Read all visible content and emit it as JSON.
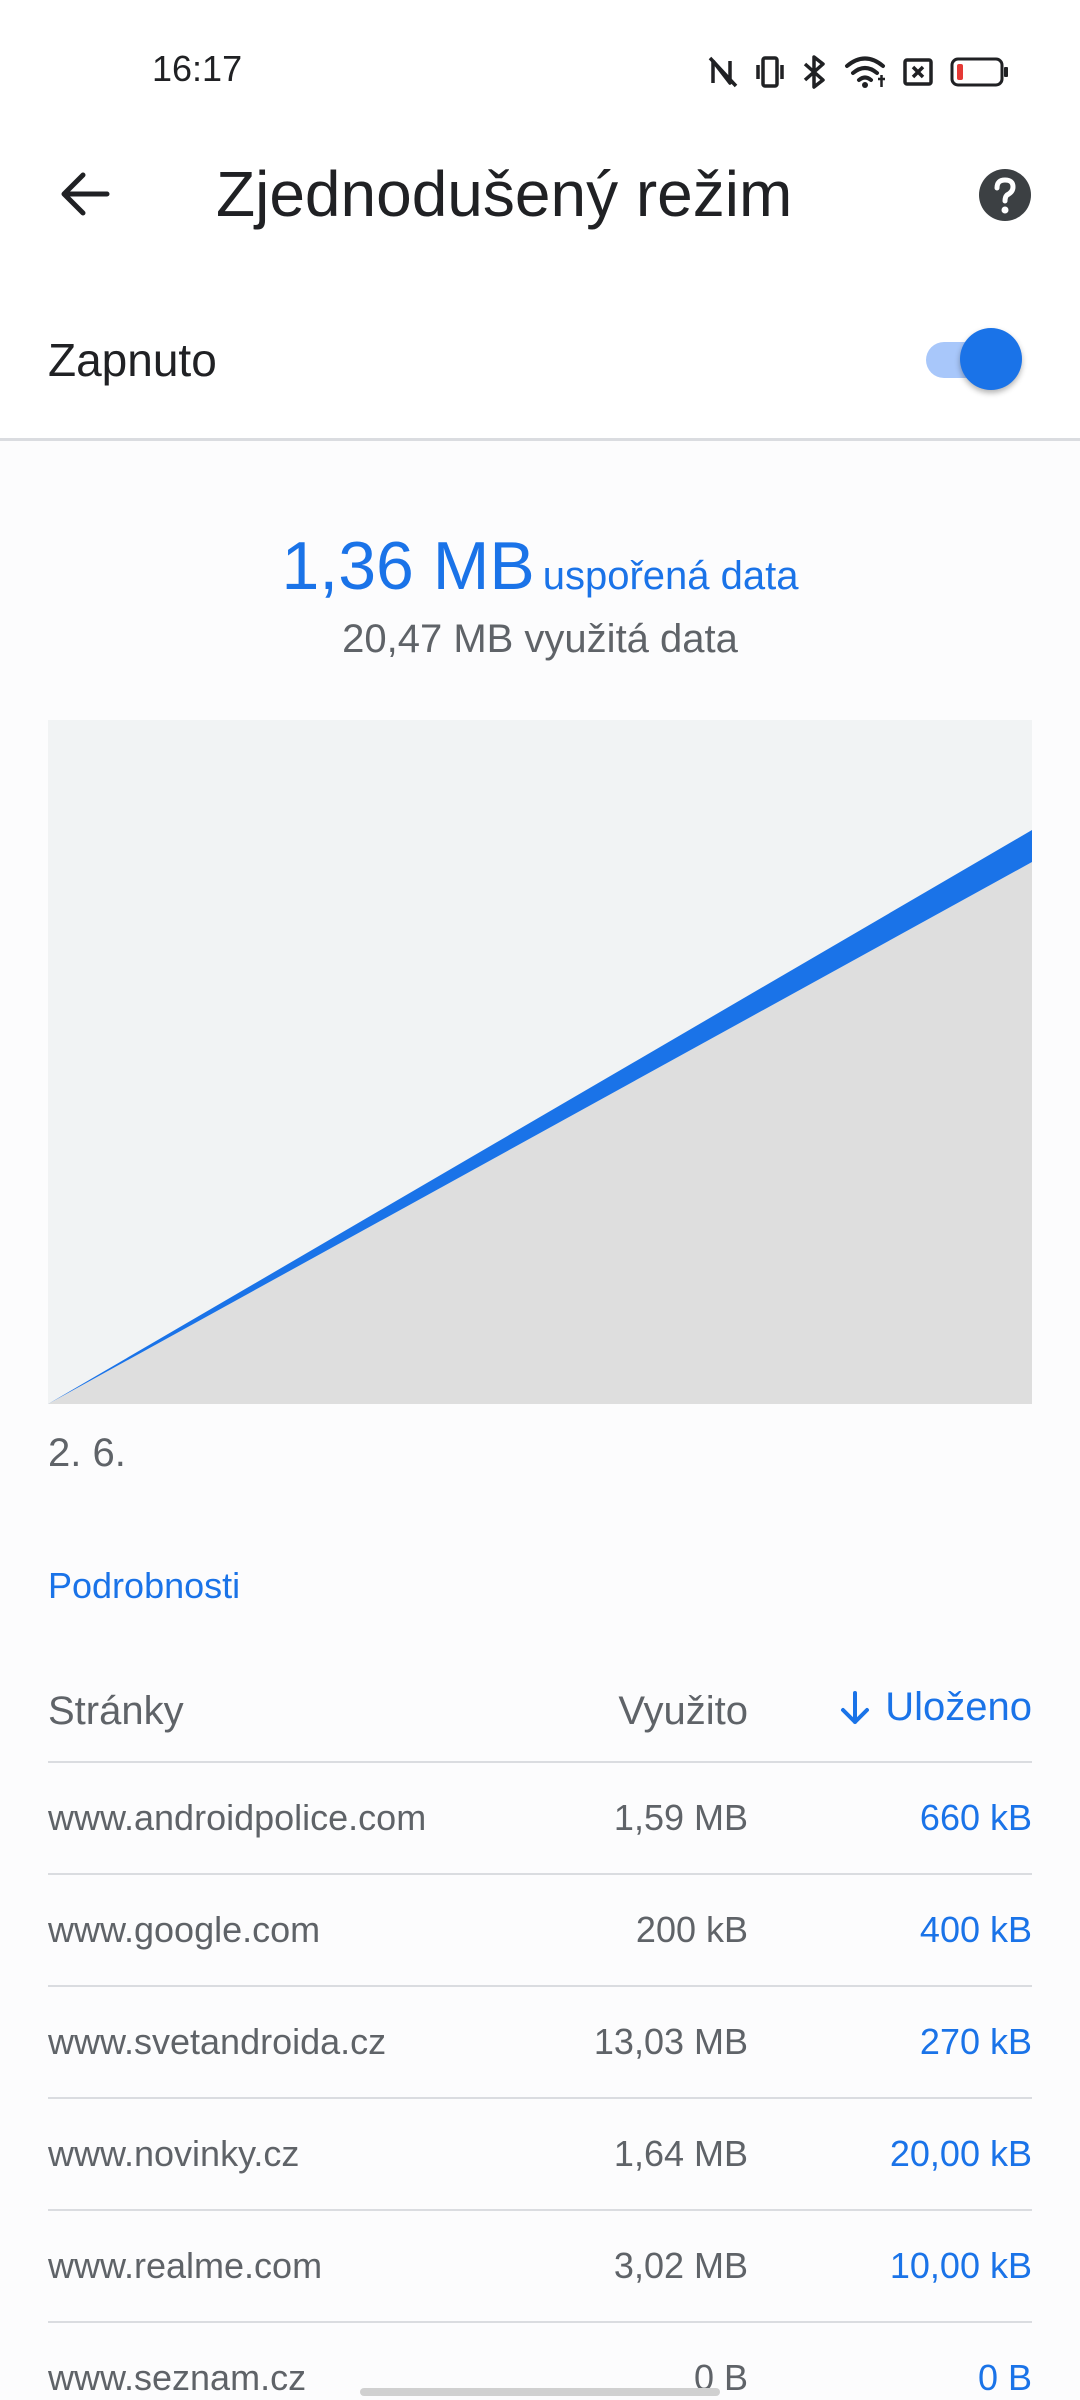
{
  "status_bar": {
    "time": "16:17",
    "icons": [
      "nfc-off-icon",
      "vibrate-icon",
      "bluetooth-icon",
      "wifi-icon",
      "sim-off-icon",
      "battery-low-icon"
    ]
  },
  "app_bar": {
    "title": "Zjednodušený režim",
    "back_icon": "arrow-back-icon",
    "help_icon": "help-circle-icon"
  },
  "toggle": {
    "label": "Zapnuto",
    "on": true
  },
  "summary": {
    "saved_value": "1,36 MB",
    "saved_label": "uspořená data",
    "used_text": "20,47 MB využitá data"
  },
  "chart": {
    "start_label": "2. 6."
  },
  "chart_data": {
    "type": "area",
    "x": [
      "2. 6."
    ],
    "series": [],
    "xlabel": "",
    "ylabel": "",
    "grid": false,
    "legend": "none"
  },
  "details": {
    "link_label": "Podrobnosti"
  },
  "table": {
    "headers": {
      "site": "Stránky",
      "used": "Využito",
      "saved": "Uloženo"
    },
    "rows": [
      {
        "site": "www.androidpolice.com",
        "used": "1,59 MB",
        "saved": "660 kB"
      },
      {
        "site": "www.google.com",
        "used": "200 kB",
        "saved": "400 kB"
      },
      {
        "site": "www.svetandroida.cz",
        "used": "13,03 MB",
        "saved": "270 kB"
      },
      {
        "site": "www.novinky.cz",
        "used": "1,64 MB",
        "saved": "20,00 kB"
      },
      {
        "site": "www.realme.com",
        "used": "3,02 MB",
        "saved": "10,00 kB"
      },
      {
        "site": "www.seznam.cz",
        "used": "0 B",
        "saved": "0 B"
      }
    ]
  },
  "colors": {
    "accent": "#1a73e8",
    "switch_track": "#a8c7fa",
    "chart_background": "#f1f3f4",
    "chart_fill": "#dedede",
    "text_primary": "#202124",
    "text_secondary": "#5f6368",
    "divider": "#dadce0"
  }
}
